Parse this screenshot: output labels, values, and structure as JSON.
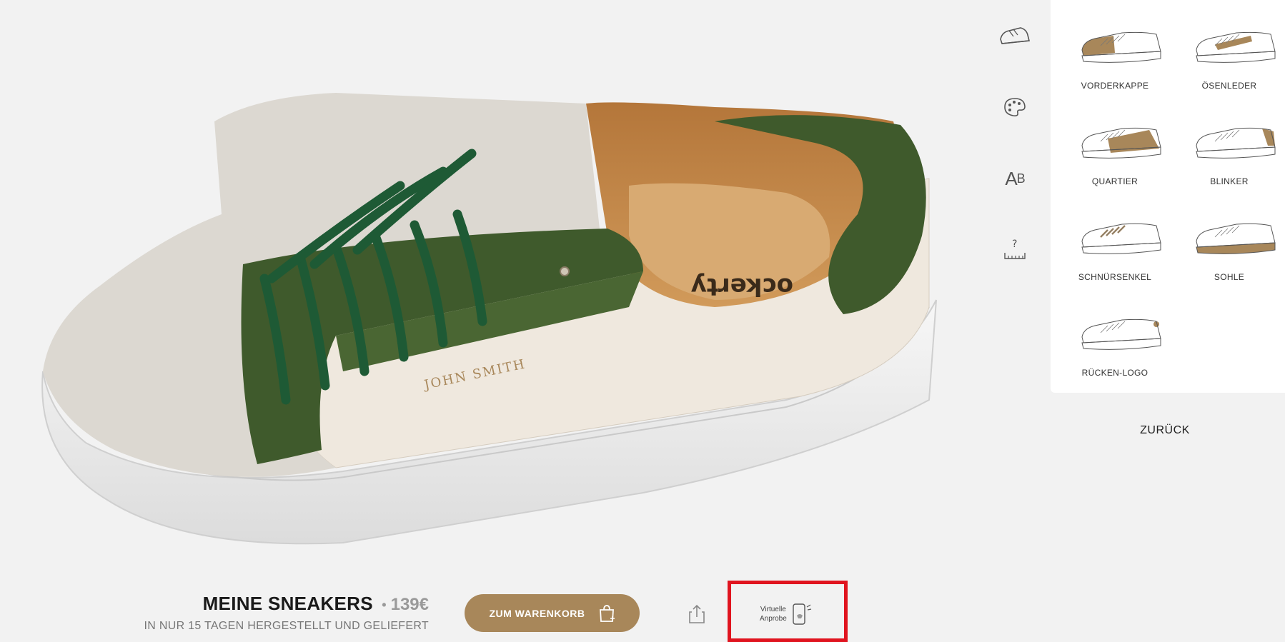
{
  "icons": {
    "shoe": "sneaker-icon",
    "palette": "palette-icon",
    "text": "text-ab-icon",
    "size": "size-ruler-icon",
    "share": "share-icon",
    "cart": "shopping-bag-icon",
    "phone": "phone-ar-icon"
  },
  "tools": {
    "text_label_main": "A",
    "text_label_small": "B",
    "size_label": "?"
  },
  "parts": [
    {
      "label": "VORDERKAPPE",
      "highlight": "toe"
    },
    {
      "label": "ÖSENLEDER",
      "highlight": "eyelet"
    },
    {
      "label": "QUARTIER",
      "highlight": "quarter"
    },
    {
      "label": "BLINKER",
      "highlight": "heel"
    },
    {
      "label": "SCHNÜRSENKEL",
      "highlight": "laces"
    },
    {
      "label": "SOHLE",
      "highlight": "sole"
    },
    {
      "label": "RÜCKEN-LOGO",
      "highlight": "logo"
    }
  ],
  "back_label": "ZURÜCK",
  "product": {
    "title": "MEINE SNEAKERS",
    "price_sep": "•",
    "price": "139€",
    "subtitle": "IN NUR 15 TAGEN HERGESTELLT UND GELIEFERT"
  },
  "cart_label": "ZUM WARENKORB",
  "vto": {
    "line1": "Virtuelle",
    "line2": "Anprobe"
  },
  "shoe": {
    "personalization": "JOHN SMITH",
    "insole_brand": "ockerty"
  },
  "colors": {
    "accent": "#a8875a",
    "green": "#3f5a2c",
    "lace_green": "#1e5a35",
    "felt": "#dcd8d1",
    "leather": "#efe8de",
    "highlight_box": "#e0141f"
  }
}
